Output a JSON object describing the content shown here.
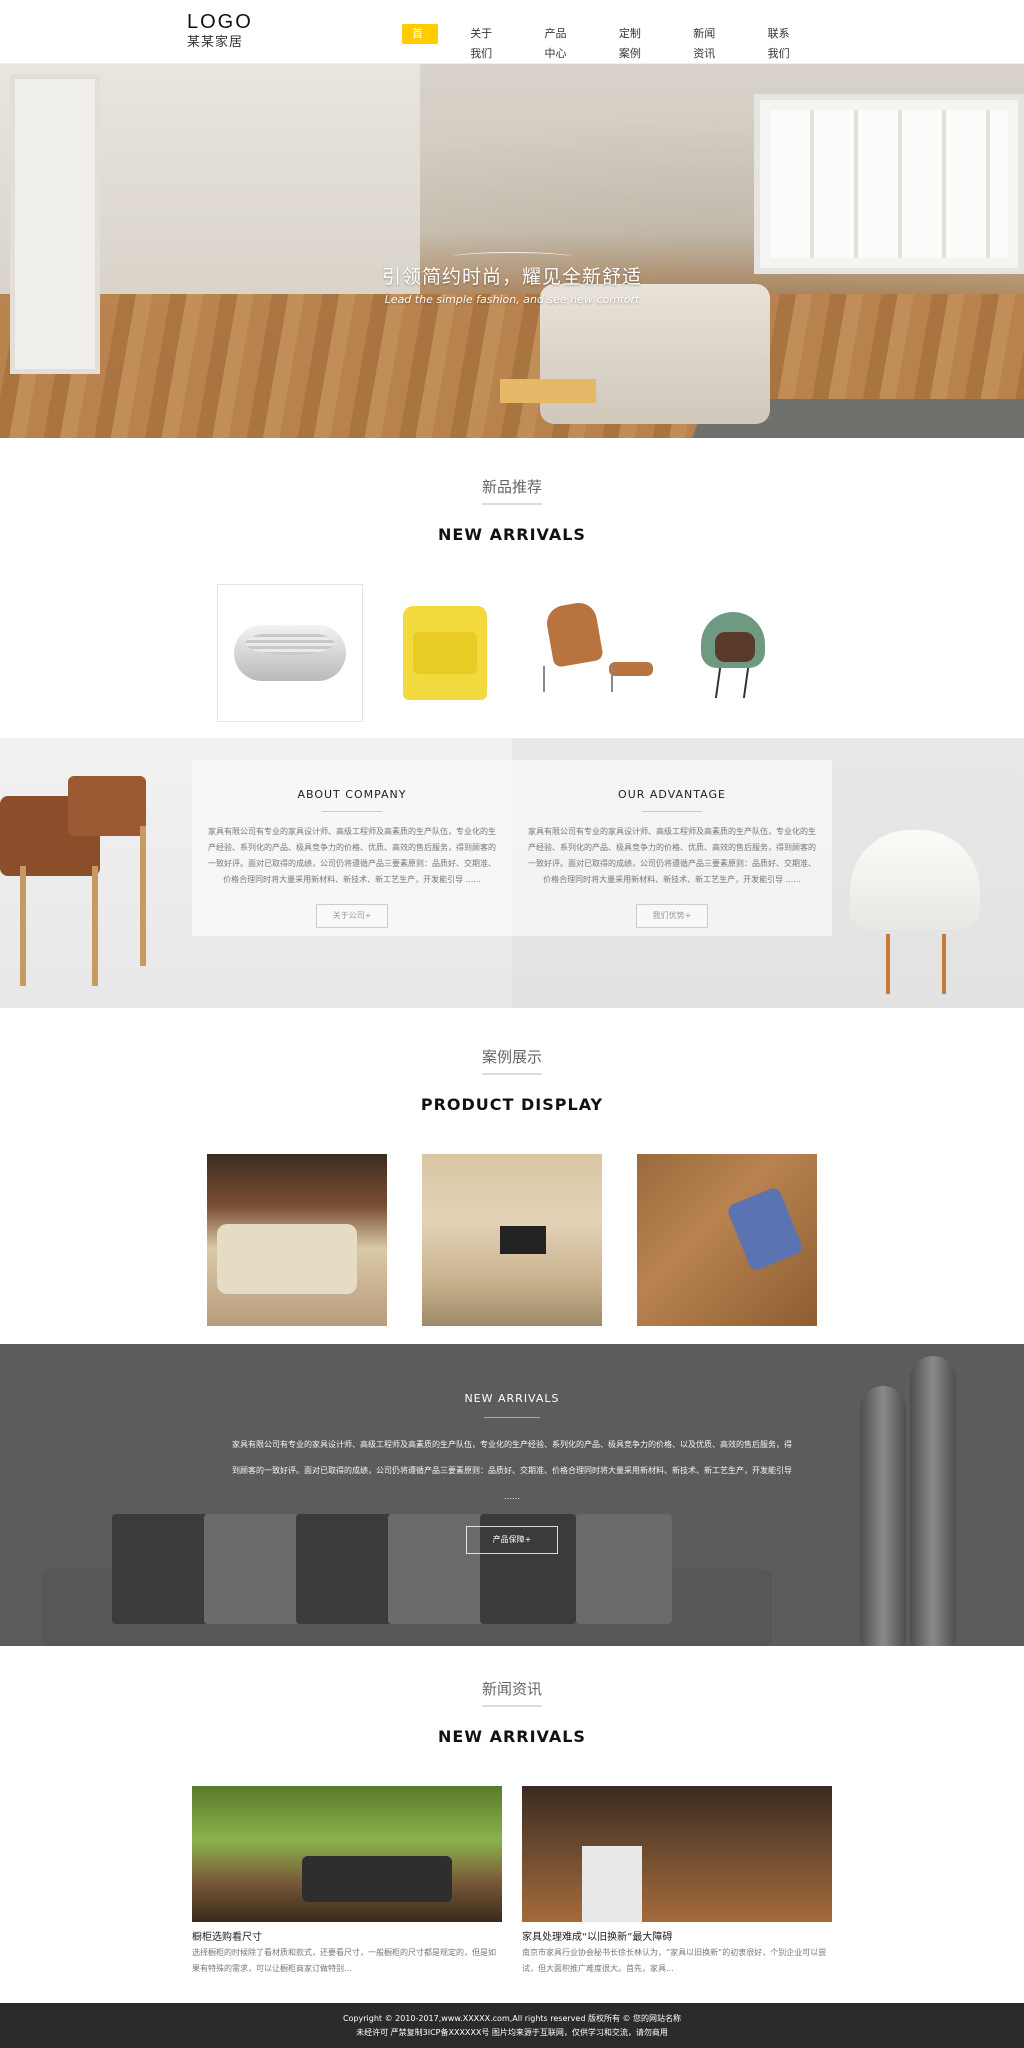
{
  "header": {
    "logo": "LOGO",
    "brand": "某某家居",
    "nav": [
      {
        "label": "首页"
      },
      {
        "label": "关于我们"
      },
      {
        "label": "产品中心"
      },
      {
        "label": "定制案例"
      },
      {
        "label": "新闻资讯"
      },
      {
        "label": "联系我们"
      }
    ],
    "accent": "#ffcc00"
  },
  "hero": {
    "slogan_cn": "引领简约时尚，耀见全新舒适",
    "slogan_en": "Lead the simple fashion, and see new comfort"
  },
  "new_arrivals": {
    "title_cn": "新品推荐",
    "title_en": "NEW ARRIVALS"
  },
  "about": {
    "company": {
      "title": "ABOUT COMPANY",
      "text": "家具有限公司有专业的家具设计师、高级工程师及高素质的生产队伍，专业化的生产经验、系列化的产品、极具竞争力的价格、优质、高效的售后服务，得到顾客的一致好评。面对已取得的成绩，公司仍将遵循产品三要素原则：品质好、交期准、价格合理同时将大量采用新材料、新技术、新工艺生产，开发能引导 ......",
      "button": "关于公司+"
    },
    "advantage": {
      "title": "OUR ADVANTAGE",
      "text": "家具有限公司有专业的家具设计师、高级工程师及高素质的生产队伍，专业化的生产经验、系列化的产品、极具竞争力的价格、优质、高效的售后服务，得到顾客的一致好评。面对已取得的成绩，公司仍将遵循产品三要素原则：品质好、交期准、价格合理同时将大量采用新材料、新技术、新工艺生产，开发能引导 ......",
      "button": "我们优势+"
    }
  },
  "display": {
    "title_cn": "案例展示",
    "title_en": "PRODUCT DISPLAY"
  },
  "band": {
    "title": "NEW ARRIVALS",
    "text": "家具有限公司有专业的家具设计师、高级工程师及高素质的生产队伍，专业化的生产经验、系列化的产品、极具竞争力的价格、以及优质、高效的售后服务，得到顾客的一致好评。面对已取得的成绩，公司仍将遵循产品三要素原则：品质好、交期准、价格合理同时将大量采用新材料、新技术、新工艺生产，开发能引导 ......",
    "button": "产品保障+"
  },
  "news": {
    "title_cn": "新闻资讯",
    "title_en": "NEW ARRIVALS",
    "items": [
      {
        "title": "橱柜选购看尺寸",
        "excerpt": "选择橱柜的时候除了看材质和款式，还要看尺寸，一般橱柜的尺寸都是规定的，但是如果有特殊的需求，可以让橱柜商家订做特别..."
      },
      {
        "title": "家具处理难成“以旧换新”最大障碍",
        "excerpt": "南京市家具行业协会秘书长徐长林认为，“家具以旧换新”的初衷很好，个别企业可以尝试，但大面积推广难度很大。首先，家具..."
      }
    ]
  },
  "footer": {
    "line1": "Copyright © 2010-2017,www.XXXXX.com,All rights reserved  版权所有 © 您的网站名称",
    "line2": "未经许可 严禁复制3ICP备XXXXXX号     图片均来源于互联网，仅供学习和交流，请勿商用"
  }
}
